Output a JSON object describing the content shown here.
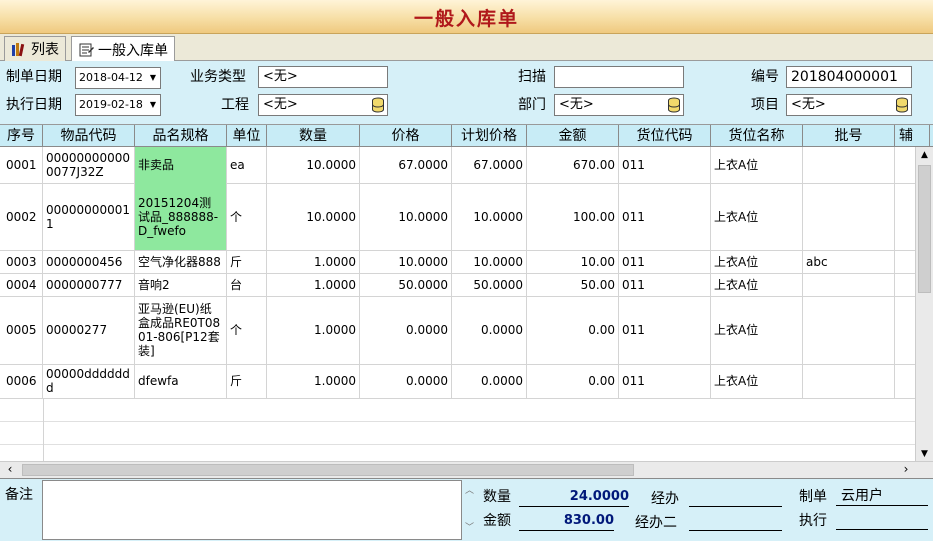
{
  "title": "一般入库单",
  "tabs": [
    {
      "label": "列表",
      "icon": "books-icon"
    },
    {
      "label": "一般入库单",
      "icon": "form-icon"
    }
  ],
  "form": {
    "make_date_label": "制单日期",
    "make_date": "2018-04-12",
    "exec_date_label": "执行日期",
    "exec_date": "2019-02-18",
    "biz_type_label": "业务类型",
    "biz_type": "<无>",
    "project_eng_label": "工程",
    "project_eng": "<无>",
    "scan_label": "扫描",
    "scan_value": "",
    "dept_label": "部门",
    "dept": "<无>",
    "number_label": "编号",
    "number": "201804000001",
    "item_label": "项目",
    "item": "<无>"
  },
  "grid": {
    "columns": [
      "序号",
      "物品代码",
      "品名规格",
      "单位",
      "数量",
      "价格",
      "计划价格",
      "金额",
      "货位代码",
      "货位名称",
      "批号",
      "辅"
    ],
    "rows": [
      [
        "0001",
        "000000000000077J32Z",
        "非卖品",
        "ea",
        "10.0000",
        "67.0000",
        "67.0000",
        "670.00",
        "011",
        "上衣A位",
        ""
      ],
      [
        "0002",
        "000000000011",
        "20151204测试品_888888-D_fwefo",
        "个",
        "10.0000",
        "10.0000",
        "10.0000",
        "100.00",
        "011",
        "上衣A位",
        ""
      ],
      [
        "0003",
        "0000000456",
        "空气净化器888",
        "斤",
        "1.0000",
        "10.0000",
        "10.0000",
        "10.00",
        "011",
        "上衣A位",
        "abc"
      ],
      [
        "0004",
        "0000000777",
        "音响2",
        "台",
        "1.0000",
        "50.0000",
        "50.0000",
        "50.00",
        "011",
        "上衣A位",
        ""
      ],
      [
        "0005",
        "00000277",
        "亚马逊(EU)纸盒成品RE0T0801-806[P12套装]",
        "个",
        "1.0000",
        "0.0000",
        "0.0000",
        "0.00",
        "011",
        "上衣A位",
        ""
      ],
      [
        "0006",
        "00000ddddddd",
        "dfewfa",
        "斤",
        "1.0000",
        "0.0000",
        "0.0000",
        "0.00",
        "011",
        "上衣A位",
        ""
      ]
    ]
  },
  "bottom": {
    "remark_label": "备注",
    "qty_label": "数量",
    "qty_value": "24.0000",
    "amount_label": "金额",
    "amount_value": "830.00",
    "handler_label": "经办",
    "handler_value": "",
    "handler2_label": "经办二",
    "handler2_value": "",
    "maker_label": "制单",
    "maker_value": "云用户",
    "executor_label": "执行",
    "executor_value": ""
  },
  "colors": {
    "title": "#b0181b",
    "panel": "#d6f0f8",
    "header": "#c8ecf6",
    "highlight": "#8ee89e",
    "sum_value": "#00187a"
  }
}
